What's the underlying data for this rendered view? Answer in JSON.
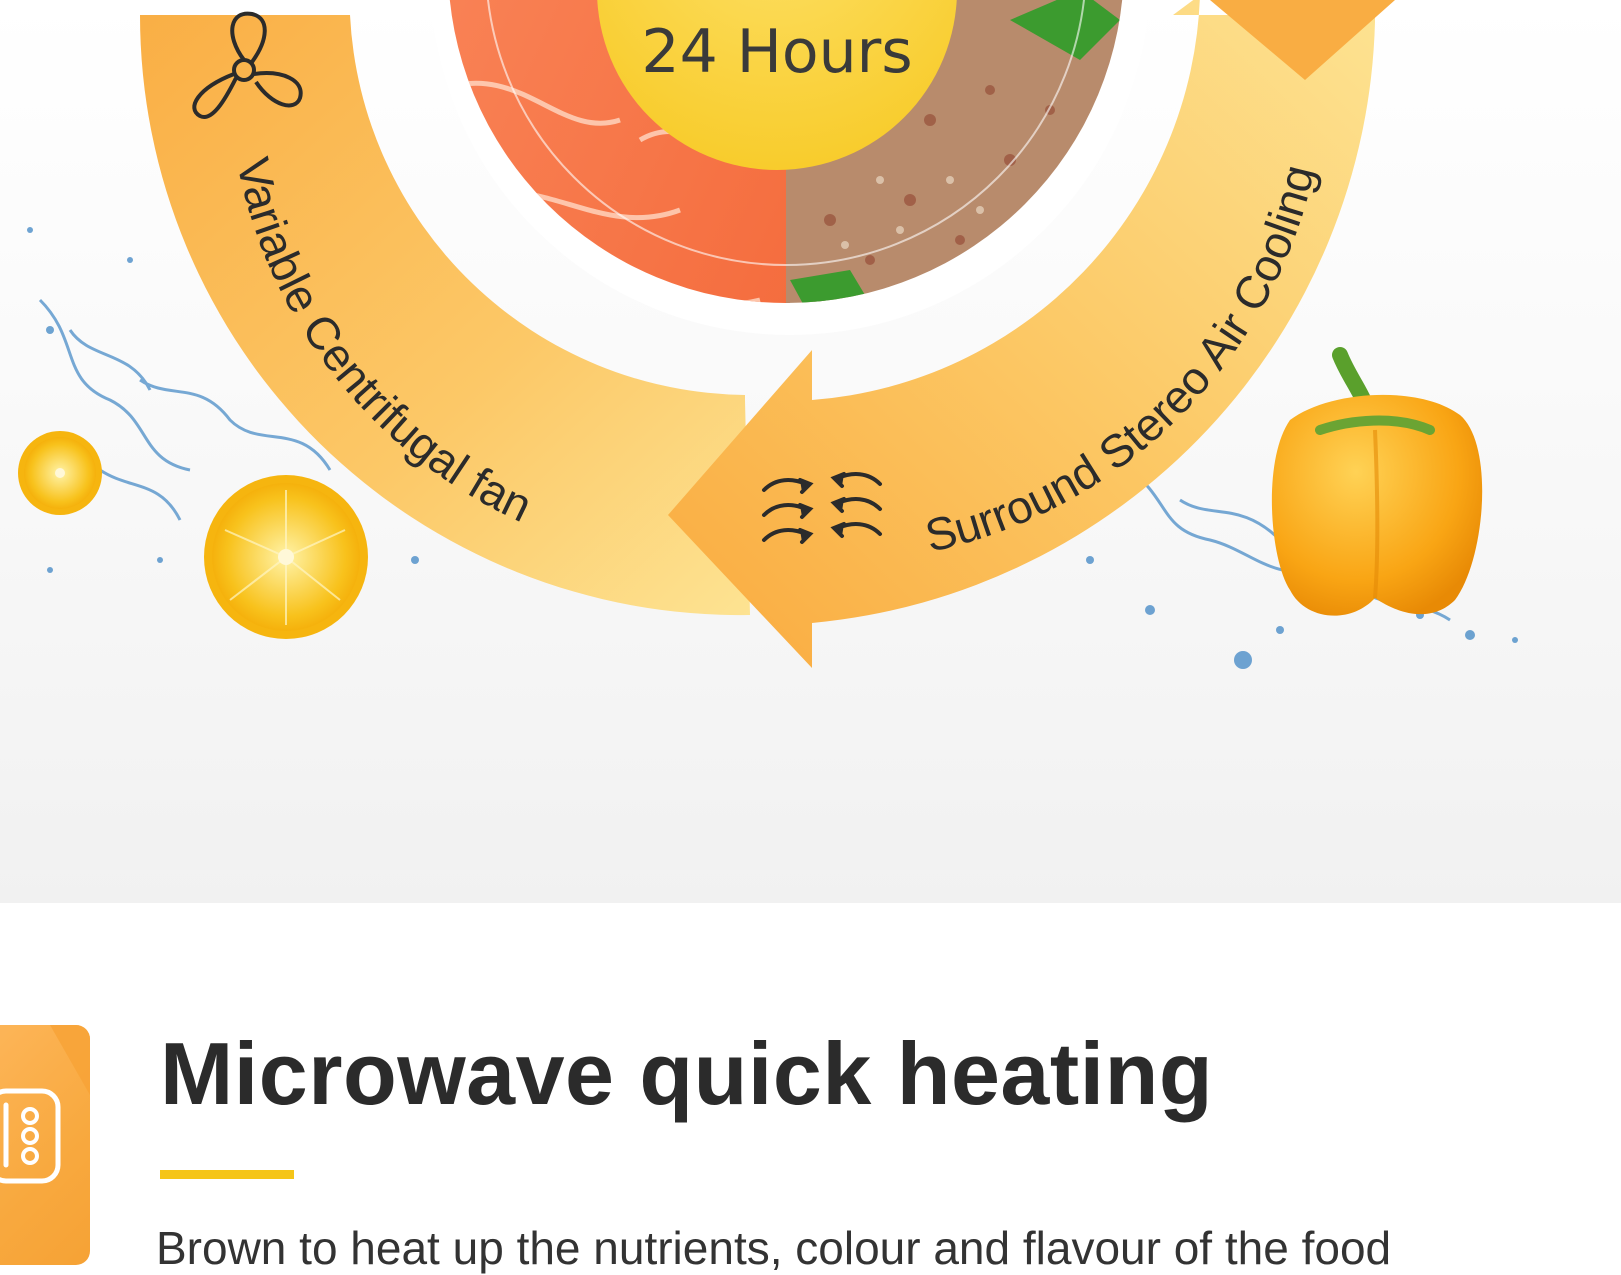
{
  "diagram": {
    "center_label": "24 Hours",
    "left_arc_label": "Variable Centrifugal fan",
    "right_arc_label": "Surround Stereo Air Cooling"
  },
  "feature": {
    "title": "Microwave quick heating",
    "description": "Brown to heat up the nutrients, colour and flavour of the food"
  },
  "colors": {
    "arrow_light": "#fde08a",
    "arrow_mid": "#fcc65c",
    "arrow_dark": "#f9a83f",
    "accent_yellow": "#f5c518",
    "title_text": "#2b2b2b"
  },
  "icons": [
    "fan-icon",
    "airflow-arrows-icon",
    "microwave-icon"
  ]
}
